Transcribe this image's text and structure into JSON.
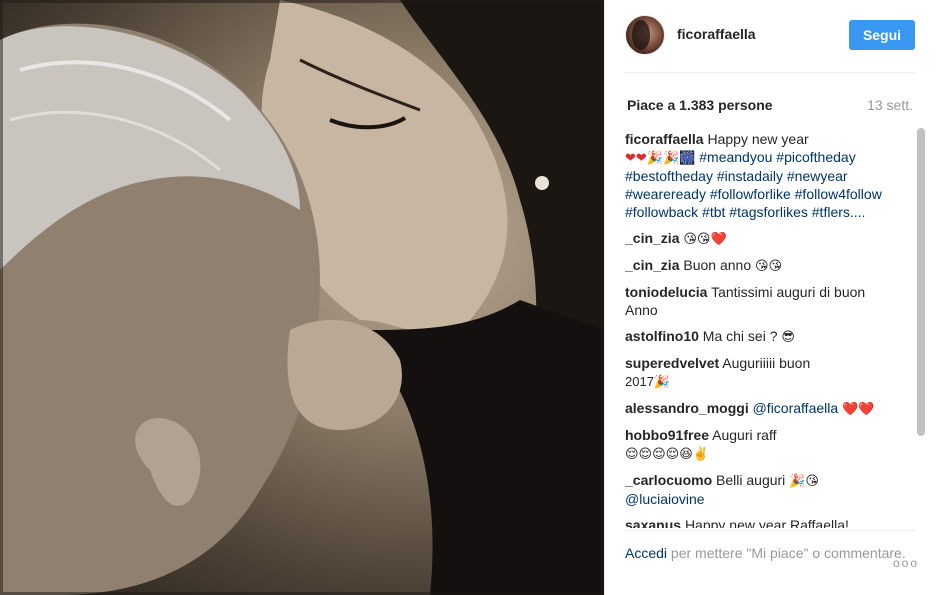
{
  "header": {
    "username": "ficoraffaella",
    "follow_label": "Segui"
  },
  "stats": {
    "likes": "Piace a 1.383 persone",
    "time": "13 sett."
  },
  "caption": {
    "user": "ficoraffaella",
    "text": "Happy new year",
    "emojis": "❤❤🎉🎉🎆",
    "tags": "#meandyou #picoftheday #bestoftheday #instadaily #newyear #weareready #followforlike #follow4follow #followback #tbt #tagsforlikes #tflers...."
  },
  "comments": [
    {
      "user": "_cin_zia",
      "text": "",
      "emojis": "😘😘❤️"
    },
    {
      "user": "_cin_zia",
      "text": "Buon anno",
      "emojis": "😘😘"
    },
    {
      "user": "toniodelucia",
      "text": "Tantissimi auguri di buon Anno",
      "emojis": ""
    },
    {
      "user": "astolfino10",
      "text": "Ma chi sei ?",
      "emojis": "😎"
    },
    {
      "user": "superedvelvet",
      "text": "Auguriiiii buon",
      "emojis": "2017🎉"
    },
    {
      "user": "alessandro_moggi",
      "text": "@ficoraffaella",
      "emojis": "❤️❤️"
    },
    {
      "user": "hobbo91free",
      "text": "Auguri raff",
      "emojis": "😌😌😌😌😆✌️"
    },
    {
      "user": "_carlocuomo",
      "text": "Belli auguri",
      "emojis": "🎉😘",
      "mention": "@luciaiovine"
    },
    {
      "user": "saxanus",
      "text": "Happy new year Raffaella!",
      "emojis": ""
    }
  ],
  "footer": {
    "login_link": "Accedi",
    "text": "per mettere \"Mi piace\" o commentare.",
    "more_label": "ooo"
  }
}
